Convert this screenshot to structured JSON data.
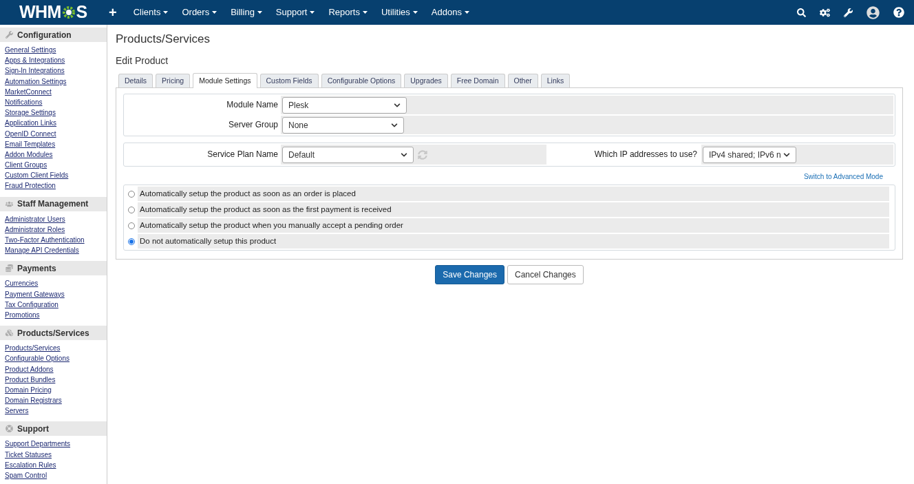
{
  "navbar": {
    "logo_left": "WHM",
    "logo_right": "S",
    "add": "+",
    "menus": [
      "Clients",
      "Orders",
      "Billing",
      "Support",
      "Reports",
      "Utilities",
      "Addons"
    ]
  },
  "sidebar": [
    {
      "title": "Configuration",
      "links": [
        "General Settings",
        "Apps & Integrations",
        "Sign-In Integrations",
        "Automation Settings",
        "MarketConnect",
        "Notifications",
        "Storage Settings",
        "Application Links",
        "OpenID Connect",
        "Email Templates",
        "Addon Modules",
        "Client Groups",
        "Custom Client Fields",
        "Fraud Protection"
      ]
    },
    {
      "title": "Staff Management",
      "links": [
        "Administrator Users",
        "Administrator Roles",
        "Two-Factor Authentication",
        "Manage API Credentials"
      ]
    },
    {
      "title": "Payments",
      "links": [
        "Currencies",
        "Payment Gateways",
        "Tax Configuration",
        "Promotions"
      ]
    },
    {
      "title": "Products/Services",
      "links": [
        "Products/Services",
        "Configurable Options",
        "Product Addons",
        "Product Bundles",
        "Domain Pricing",
        "Domain Registrars",
        "Servers"
      ]
    },
    {
      "title": "Support",
      "links": [
        "Support Departments",
        "Ticket Statuses",
        "Escalation Rules",
        "Spam Control"
      ]
    }
  ],
  "page_title": "Products/Services",
  "subtitle": "Edit Product",
  "tabs": [
    {
      "label": "Details",
      "selected": false
    },
    {
      "label": "Pricing",
      "selected": false
    },
    {
      "label": "Module Settings",
      "selected": true
    },
    {
      "label": "Custom Fields",
      "selected": false
    },
    {
      "label": "Configurable Options",
      "selected": false
    },
    {
      "label": "Upgrades",
      "selected": false
    },
    {
      "label": "Free Domain",
      "selected": false
    },
    {
      "label": "Other",
      "selected": false
    },
    {
      "label": "Links",
      "selected": false
    }
  ],
  "module_fields": [
    {
      "label": "Module Name",
      "value": "Plesk"
    },
    {
      "label": "Server Group",
      "value": "None"
    }
  ],
  "service_plan": {
    "label": "Service Plan Name",
    "value": "Default"
  },
  "ip_field": {
    "label": "Which IP addresses to use?",
    "value": "IPv4 shared; IPv6 n"
  },
  "advanced_link": "Switch to Advanced Mode",
  "setup_options": [
    {
      "label": "Automatically setup the product as soon as an order is placed",
      "selected": false
    },
    {
      "label": "Automatically setup the product as soon as the first payment is received",
      "selected": false
    },
    {
      "label": "Automatically setup the product when you manually accept a pending order",
      "selected": false
    },
    {
      "label": "Do not automatically setup this product",
      "selected": true
    }
  ],
  "buttons": {
    "save": "Save Changes",
    "cancel": "Cancel Changes"
  }
}
